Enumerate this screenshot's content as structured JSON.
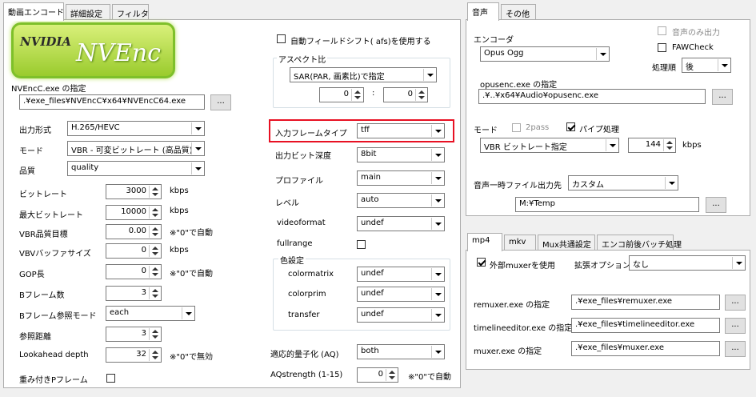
{
  "tabs_left": [
    "動画エンコード",
    "詳細設定",
    "フィルタ"
  ],
  "tabs_right": [
    "音声",
    "その他"
  ],
  "tabs_mux": [
    "mp4",
    "mkv",
    "Mux共通設定",
    "エンコ前後バッチ処理"
  ],
  "logo": {
    "line1": "NVIDIA",
    "line2": "NVEnc"
  },
  "exe": {
    "label": "NVEncC.exe の指定",
    "path": ".¥exe_files¥NVEncC¥x64¥NVEncC64.exe",
    "browse": "..."
  },
  "video": {
    "output_format_label": "出力形式",
    "output_format": "H.265/HEVC",
    "mode_label": "モード",
    "mode": "VBR - 可変ビットレート (高品質)",
    "quality_label": "品質",
    "quality": "quality",
    "bitrate_label": "ビットレート",
    "bitrate": "3000",
    "bitrate_unit": "kbps",
    "maxbitrate_label": "最大ビットレート",
    "maxbitrate": "10000",
    "maxbitrate_unit": "kbps",
    "vbrq_label": "VBR品質目標",
    "vbrq": "0.00",
    "vbrq_note": "※\"0\"で自動",
    "vbv_label": "VBVバッファサイズ",
    "vbv": "0",
    "vbv_unit": "kbps",
    "gop_label": "GOP長",
    "gop": "0",
    "gop_note": "※\"0\"で自動",
    "bframes_label": "Bフレーム数",
    "bframes": "3",
    "bref_label": "Bフレーム参照モード",
    "bref": "each",
    "ref_label": "参照距離",
    "ref": "3",
    "lookahead_label": "Lookahead depth",
    "lookahead": "32",
    "lookahead_note": "※\"0\"で無効",
    "weightp_label": "重み付きPフレーム"
  },
  "mid": {
    "afs_label": "自動フィールドシフト( afs)を使用する",
    "aspect_title": "アスペクト比",
    "aspect": "SAR(PAR, 画素比)で指定",
    "aspect_x": "0",
    "aspect_sep": ":",
    "aspect_y": "0",
    "frametype_label": "入力フレームタイプ",
    "frametype": "tff",
    "depth_label": "出力ビット深度",
    "depth": "8bit",
    "profile_label": "プロファイル",
    "profile": "main",
    "level_label": "レベル",
    "level": "auto",
    "videoformat_label": "videoformat",
    "videoformat": "undef",
    "fullrange_label": "fullrange",
    "color_title": "色設定",
    "colormatrix_label": "colormatrix",
    "colormatrix": "undef",
    "colorprim_label": "colorprim",
    "colorprim": "undef",
    "transfer_label": "transfer",
    "transfer": "undef",
    "aq_label": "適応的量子化 (AQ)",
    "aq": "both",
    "aqs_label": "AQstrength (1-15)",
    "aqs": "0",
    "aqs_note": "※\"0\"で自動"
  },
  "audio": {
    "encoder_label": "エンコーダ",
    "encoder": "Opus Ogg",
    "audio_only_label": "音声のみ出力",
    "faw_label": "FAWCheck",
    "order_label": "処理順",
    "order": "後",
    "exe_label": "opusenc.exe の指定",
    "exe_path": ".¥..¥x64¥Audio¥opusenc.exe",
    "browse": "...",
    "mode_label": "モード",
    "twopass_label": "2pass",
    "pipe_label": "パイプ処理",
    "mode": "VBR ビットレート指定",
    "bitrate": "144",
    "bitrate_unit": "kbps",
    "temp_label": "音声一時ファイル出力先",
    "temp_mode": "カスタム",
    "temp_path": "M:¥Temp",
    "temp_browse": "..."
  },
  "mux": {
    "use_label": "外部muxerを使用",
    "ext_label": "拡張オプション",
    "ext": "なし",
    "remuxer_label": "remuxer.exe の指定",
    "remuxer": ".¥exe_files¥remuxer.exe",
    "timeline_label": "timelineeditor.exe の指定",
    "timeline": ".¥exe_files¥timelineeditor.exe",
    "muxer_label": "muxer.exe の指定",
    "muxer": ".¥exe_files¥muxer.exe",
    "browse": "..."
  },
  "colors": {
    "highlight": "#e81123",
    "logo_green": "#7ec02a"
  }
}
